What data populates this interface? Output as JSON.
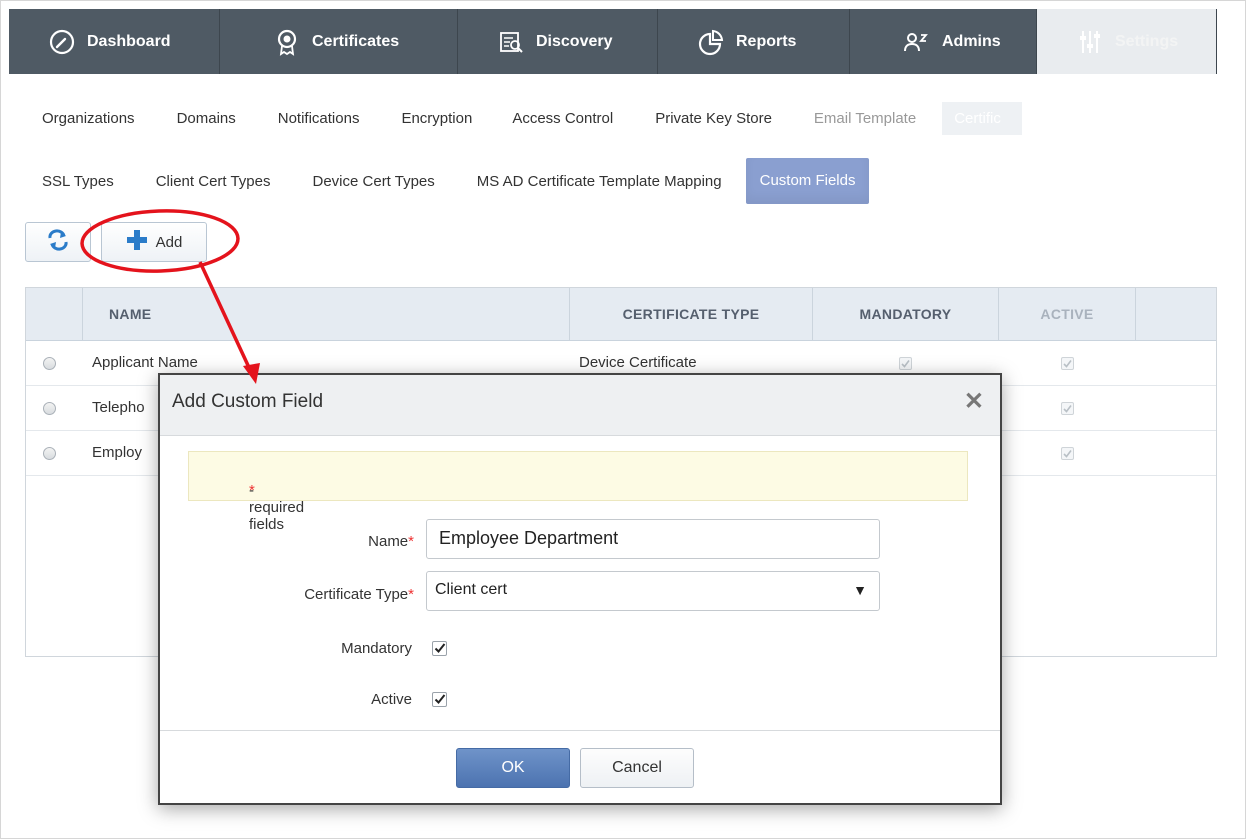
{
  "topnav": {
    "tabs": [
      {
        "label": "Dashboard",
        "icon": "gauge-icon"
      },
      {
        "label": "Certificates",
        "icon": "certificate-icon"
      },
      {
        "label": "Discovery",
        "icon": "discovery-icon"
      },
      {
        "label": "Reports",
        "icon": "pie-chart-icon"
      },
      {
        "label": "Admins",
        "icon": "admins-icon"
      },
      {
        "label": "Settings",
        "icon": "sliders-icon"
      }
    ]
  },
  "submenu1": {
    "items": [
      "Organizations",
      "Domains",
      "Notifications",
      "Encryption",
      "Access Control",
      "Private Key Store",
      "Email Template",
      "Certific"
    ]
  },
  "submenu2": {
    "items": [
      "SSL Types",
      "Client Cert Types",
      "Device Cert Types",
      "MS AD Certificate Template Mapping",
      "Custom Fields"
    ]
  },
  "toolbar": {
    "add_label": "Add"
  },
  "grid": {
    "columns": [
      "NAME",
      "CERTIFICATE TYPE",
      "MANDATORY",
      "ACTIVE"
    ],
    "rows": [
      {
        "name": "Applicant Name",
        "certificate_type": "Device Certificate"
      },
      {
        "name": "Telepho",
        "certificate_type": ""
      },
      {
        "name": "Employ",
        "certificate_type": ""
      }
    ]
  },
  "dialog": {
    "title": "Add Custom Field",
    "close": "✕",
    "notice_star": "*",
    "notice_text": "-required fields",
    "name_label": "Name",
    "name_value": "Employee Department",
    "cert_type_label": "Certificate Type",
    "cert_type_value": "Client cert",
    "mandatory_label": "Mandatory",
    "mandatory_checked": true,
    "active_label": "Active",
    "active_checked": true,
    "required_mark": "*",
    "ok_label": "OK",
    "cancel_label": "Cancel"
  },
  "colors": {
    "nav_bg": "#4f5a64",
    "active_pill": "#8a9fd0",
    "ok_button": "#4c73b0",
    "annotation": "#e4131c",
    "required": "#ee3333"
  }
}
